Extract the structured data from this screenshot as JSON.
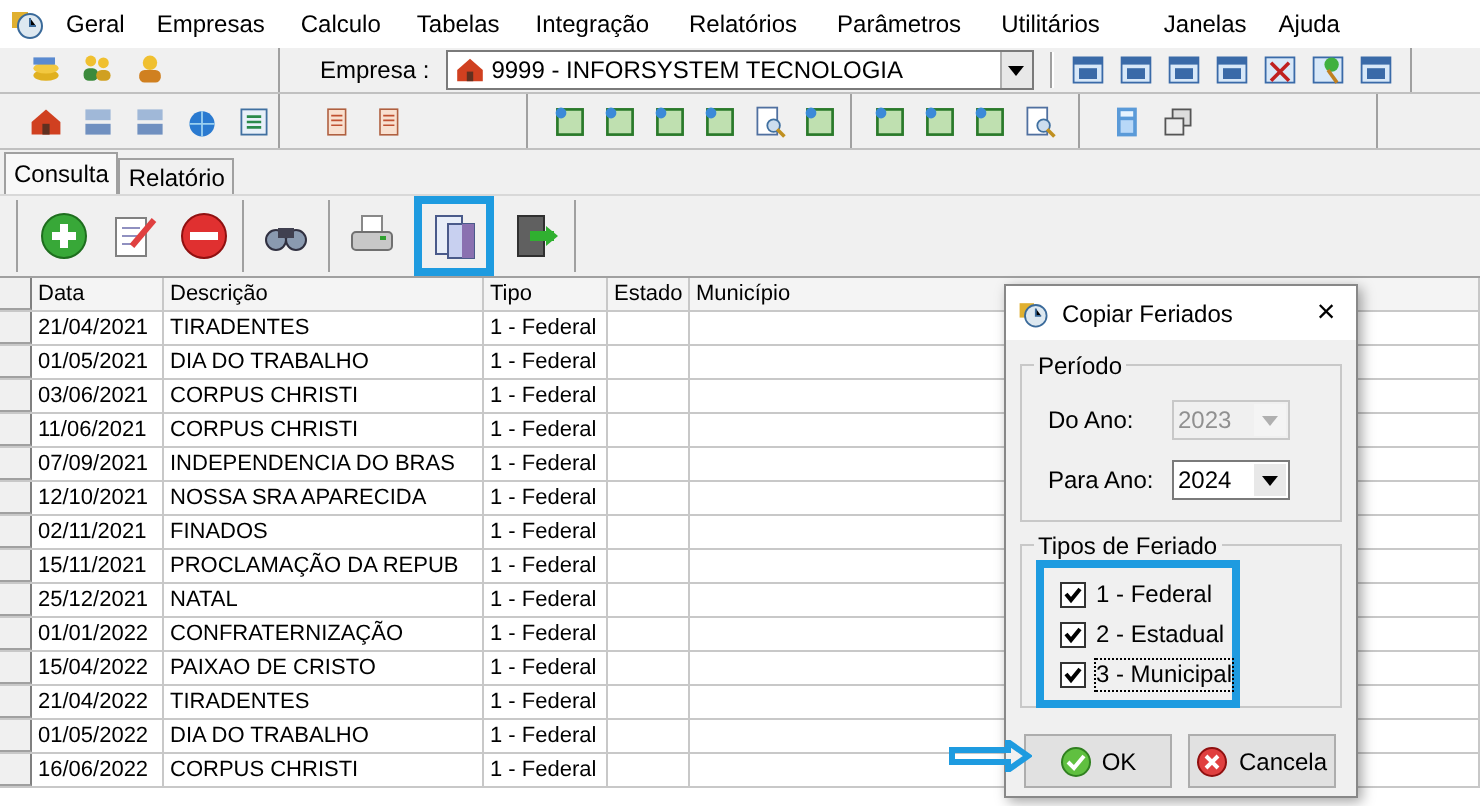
{
  "menu": [
    "Geral",
    "Empresas",
    "Calculo",
    "Tabelas",
    "Integração",
    "Relatórios",
    "Parâmetros",
    "Utilitários",
    "Janelas",
    "Ajuda"
  ],
  "company": {
    "label": "Empresa :",
    "value": "9999 - INFORSYSTEM TECNOLOGIA"
  },
  "tabs": [
    {
      "label": "Consulta",
      "selected": true
    },
    {
      "label": "Relatório",
      "selected": false
    }
  ],
  "table": {
    "columns": [
      "Data",
      "Descrição",
      "Tipo",
      "Estado",
      "Município"
    ],
    "rows": [
      [
        "21/04/2021",
        "TIRADENTES",
        "1 - Federal"
      ],
      [
        "01/05/2021",
        "DIA DO TRABALHO",
        "1 - Federal"
      ],
      [
        "03/06/2021",
        "CORPUS CHRISTI",
        "1 - Federal"
      ],
      [
        "11/06/2021",
        "CORPUS CHRISTI",
        "1 - Federal"
      ],
      [
        "07/09/2021",
        "INDEPENDENCIA DO BRAS",
        "1 - Federal"
      ],
      [
        "12/10/2021",
        "NOSSA SRA  APARECIDA",
        "1 - Federal"
      ],
      [
        "02/11/2021",
        "FINADOS",
        "1 - Federal"
      ],
      [
        "15/11/2021",
        "PROCLAMAÇÃO DA REPUB",
        "1 - Federal"
      ],
      [
        "25/12/2021",
        "NATAL",
        "1 - Federal"
      ],
      [
        "01/01/2022",
        "CONFRATERNIZAÇÃO",
        "1 - Federal"
      ],
      [
        "15/04/2022",
        "PAIXAO DE CRISTO",
        "1 - Federal"
      ],
      [
        "21/04/2022",
        "TIRADENTES",
        "1 - Federal"
      ],
      [
        "01/05/2022",
        "DIA DO TRABALHO",
        "1 - Federal"
      ],
      [
        "16/06/2022",
        "CORPUS CHRISTI",
        "1 - Federal"
      ]
    ]
  },
  "dialog": {
    "title": "Copiar Feriados",
    "close": "×",
    "period": {
      "title": "Período",
      "fields": [
        {
          "label": "Do Ano:",
          "value": "2023",
          "disabled": true
        },
        {
          "label": "Para Ano:",
          "value": "2024",
          "disabled": false
        }
      ]
    },
    "types": {
      "title": "Tipos de Feriado",
      "items": [
        {
          "label": "1 - Federal",
          "checked": true,
          "focused": false
        },
        {
          "label": "2 - Estadual",
          "checked": true,
          "focused": false
        },
        {
          "label": "3 - Municipal",
          "checked": true,
          "focused": true
        }
      ]
    },
    "buttons": [
      {
        "kind": "ok",
        "label": "OK"
      },
      {
        "kind": "cancel",
        "label": "Cancela"
      }
    ]
  }
}
